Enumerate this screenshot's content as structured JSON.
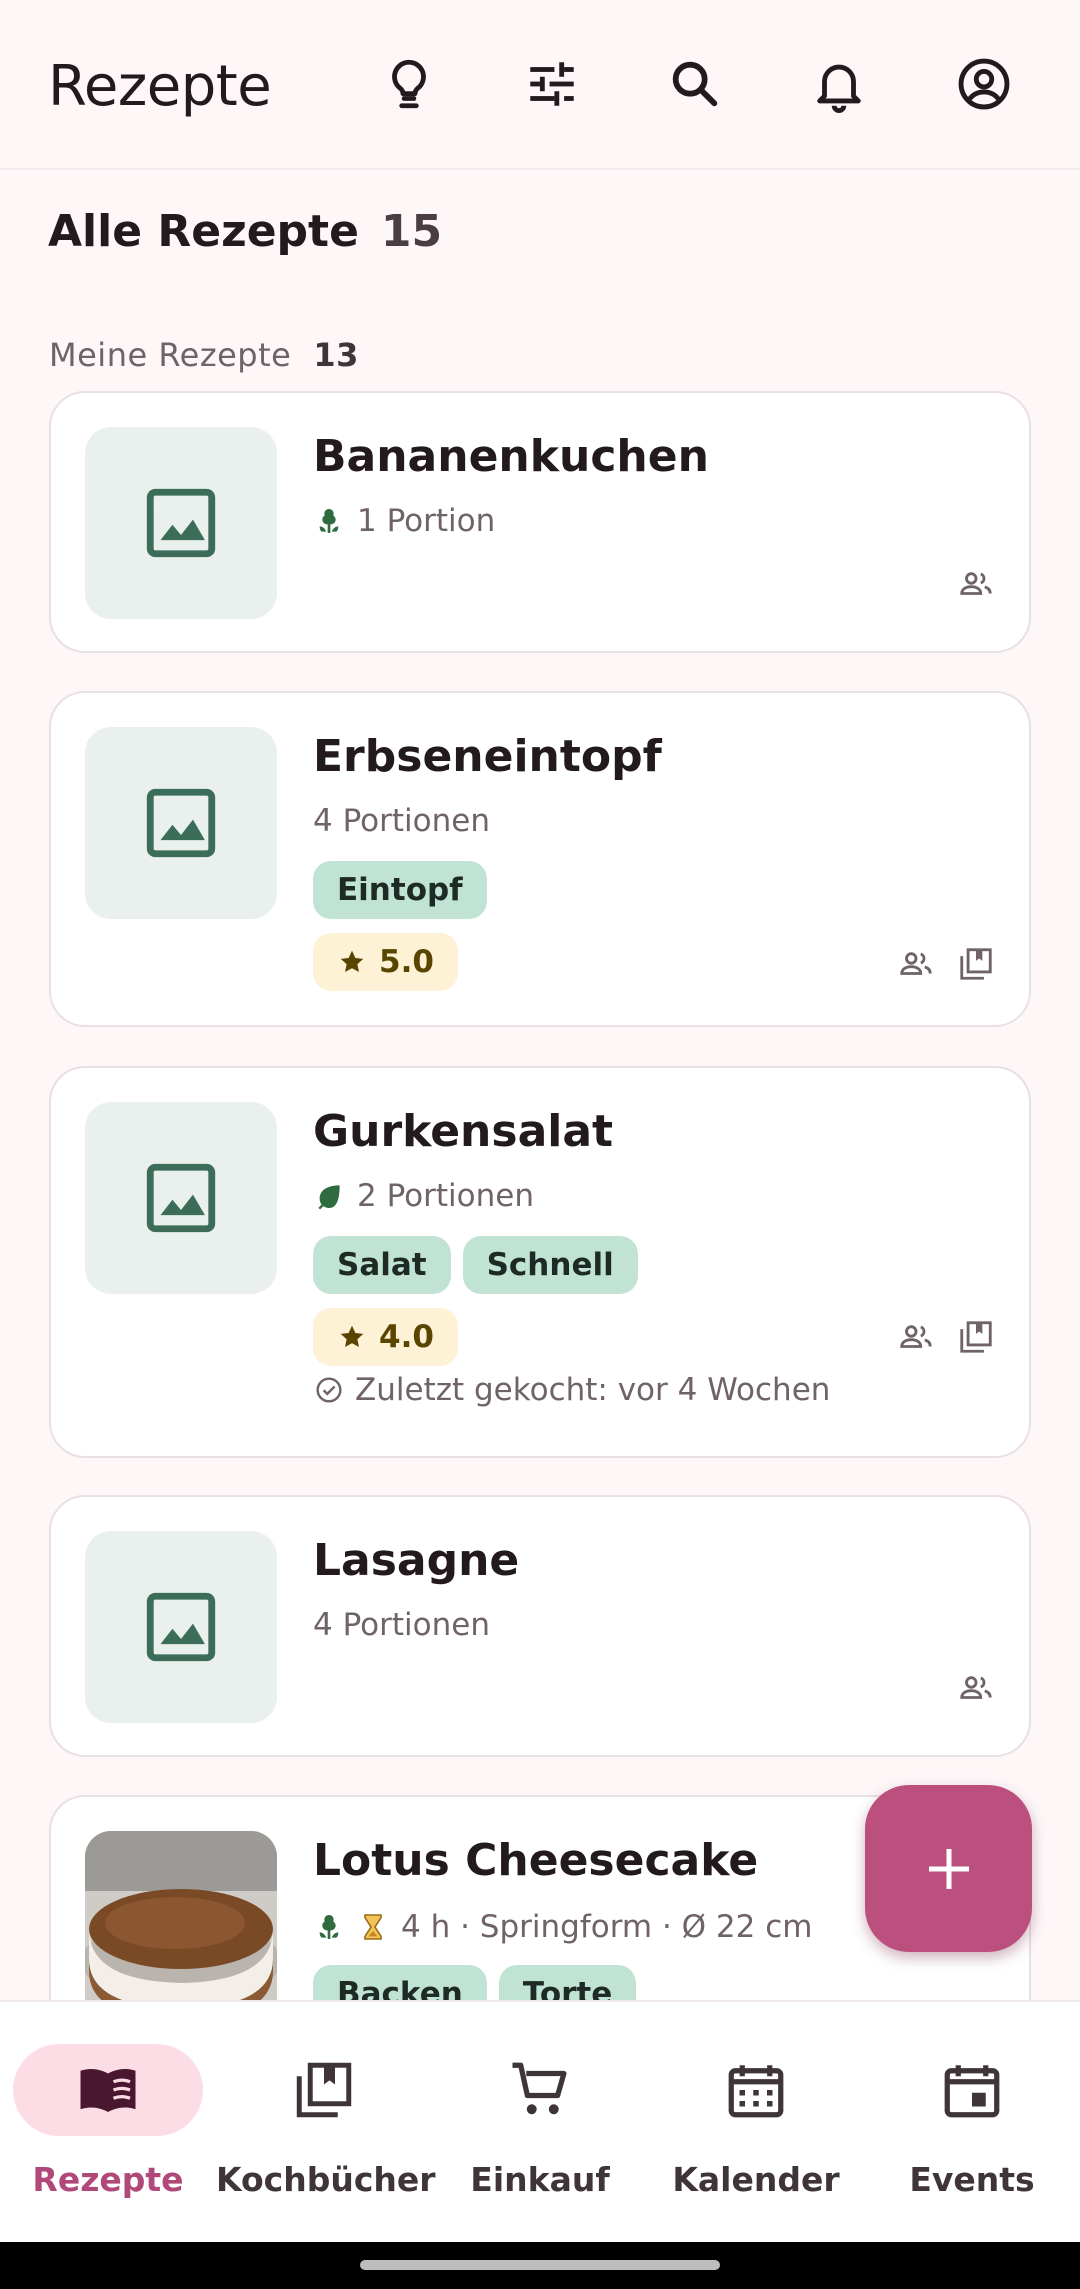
{
  "app": {
    "title": "Rezepte"
  },
  "header": {
    "icons": [
      "lightbulb-icon",
      "tune-icon",
      "search-icon",
      "bell-icon",
      "account-icon"
    ]
  },
  "all_recipes": {
    "label": "Alle Rezepte",
    "count": "15"
  },
  "my_recipes": {
    "label": "Meine Rezepte",
    "count": "13"
  },
  "recipes": [
    {
      "title": "Bananenkuchen",
      "servings": "1 Portion",
      "diet_icon": "vegetarian-icon",
      "corner_icons": [
        "shared-people-icon"
      ]
    },
    {
      "title": "Erbseneintopf",
      "servings": "4 Portionen",
      "tags": [
        "Eintopf"
      ],
      "rating": "5.0",
      "corner_icons": [
        "shared-people-icon",
        "cookbook-icon"
      ]
    },
    {
      "title": "Gurkensalat",
      "servings": "2 Portionen",
      "diet_icon": "vegan-leaf-icon",
      "tags": [
        "Salat",
        "Schnell"
      ],
      "rating": "4.0",
      "last_cooked": "Zuletzt gekocht: vor 4 Wochen",
      "corner_icons": [
        "shared-people-icon",
        "cookbook-icon"
      ]
    },
    {
      "title": "Lasagne",
      "servings": "4 Portionen",
      "corner_icons": [
        "shared-people-icon"
      ]
    },
    {
      "title": "Lotus Cheesecake",
      "meta": "4 h · Springform · Ø 22 cm",
      "diet_icon": "vegetarian-icon",
      "tags": [
        "Backen",
        "Torte"
      ]
    }
  ],
  "fab": {
    "icon": "add-icon"
  },
  "nav": [
    {
      "label": "Rezepte",
      "icon": "book-open-icon",
      "active": true
    },
    {
      "label": "Kochbücher",
      "icon": "cookbook-icon",
      "active": false
    },
    {
      "label": "Einkauf",
      "icon": "cart-icon",
      "active": false
    },
    {
      "label": "Kalender",
      "icon": "calendar-icon",
      "active": false
    },
    {
      "label": "Events",
      "icon": "event-icon",
      "active": false
    }
  ],
  "colors": {
    "accent": "#bb4f7e",
    "accent_light": "#fcdde6",
    "chip_green": "#c0e3d4",
    "rating_bg": "#fdf1d6",
    "thumb_bg": "#e9f0ed",
    "icon_green": "#3c6d58"
  }
}
